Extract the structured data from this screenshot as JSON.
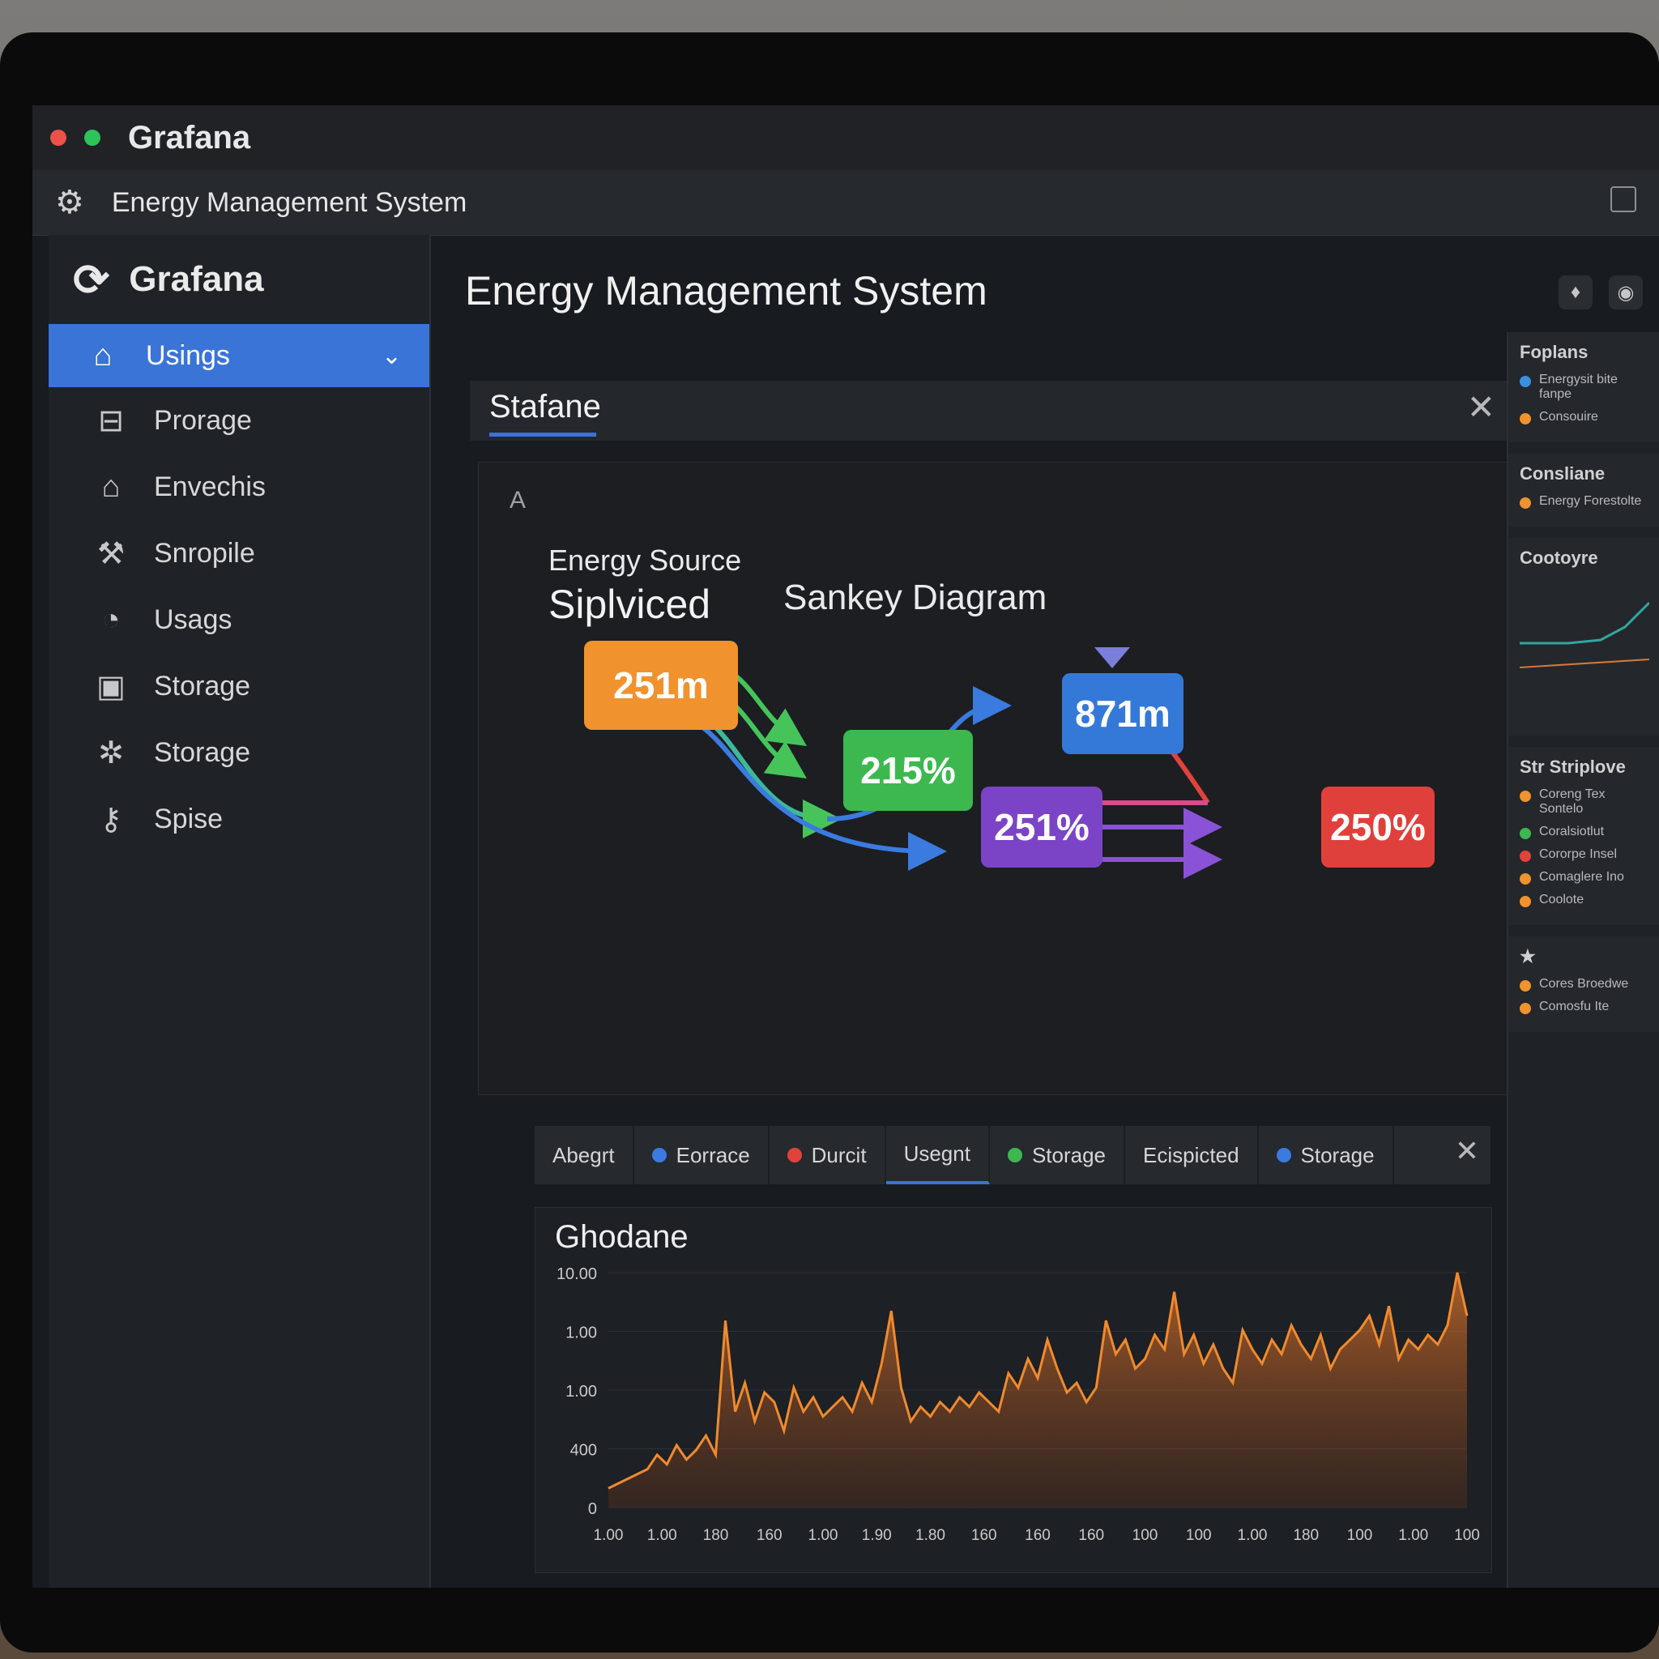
{
  "window": {
    "os_title": "Grafana",
    "app_title": "Energy Management System"
  },
  "sidebar": {
    "brand": "Grafana",
    "items": [
      {
        "label": "Usings",
        "icon": "home-icon",
        "active": true
      },
      {
        "label": "Prorage",
        "icon": "archive-icon"
      },
      {
        "label": "Envechis",
        "icon": "building-icon"
      },
      {
        "label": "Snropile",
        "icon": "tool-icon"
      },
      {
        "label": "Usags",
        "icon": "gauge-icon"
      },
      {
        "label": "Storage",
        "icon": "database-icon"
      },
      {
        "label": "Storage",
        "icon": "cog-cluster-icon"
      },
      {
        "label": "Spise",
        "icon": "key-icon"
      }
    ]
  },
  "main": {
    "page_title": "Energy Management System",
    "tab_label": "Stafane",
    "panel_marker": "A",
    "diagram": {
      "source_label": "Energy Source",
      "split_label": "Siplviced",
      "title": "Sankey Diagram",
      "nodes": [
        {
          "id": "source",
          "label": "251m",
          "color": "#f0922e"
        },
        {
          "id": "mid-green",
          "label": "215%",
          "color": "#3db84f"
        },
        {
          "id": "top-blue",
          "label": "871m",
          "color": "#3479d8"
        },
        {
          "id": "mid-purple",
          "label": "251%",
          "color": "#7b44c7"
        },
        {
          "id": "right-red",
          "label": "250%",
          "color": "#e0403c"
        }
      ]
    },
    "legend": [
      {
        "label": "Abegrt",
        "color": null
      },
      {
        "label": "Eorrace",
        "color": "#3b7be0"
      },
      {
        "label": "Durcit",
        "color": "#e0433b"
      },
      {
        "label": "Usegnt",
        "color": null,
        "selected": true
      },
      {
        "label": "Storage",
        "color": "#3db84f"
      },
      {
        "label": "Ecispicted",
        "color": null
      },
      {
        "label": "Storage",
        "color": "#3b7be0"
      }
    ],
    "chart_title": "Ghodane"
  },
  "chart_data": {
    "type": "area",
    "title": "Ghodane",
    "y_tick_labels": [
      "10.00",
      "1.00",
      "1.00",
      "400",
      "0"
    ],
    "x_tick_labels": [
      "1.00",
      "1.00",
      "180",
      "160",
      "1.00",
      "1.90",
      "1.80",
      "160",
      "160",
      "160",
      "100",
      "100",
      "1.00",
      "180",
      "100",
      "1.00",
      "100"
    ],
    "series": [
      {
        "color": "#f08a2e",
        "values": [
          8,
          10,
          12,
          14,
          16,
          22,
          18,
          26,
          20,
          24,
          30,
          22,
          78,
          40,
          52,
          36,
          48,
          44,
          32,
          50,
          40,
          46,
          38,
          42,
          46,
          40,
          52,
          44,
          60,
          82,
          50,
          36,
          42,
          38,
          44,
          40,
          46,
          42,
          48,
          44,
          40,
          56,
          50,
          62,
          54,
          70,
          58,
          48,
          52,
          44,
          50,
          78,
          64,
          70,
          58,
          62,
          72,
          66,
          90,
          64,
          72,
          60,
          68,
          58,
          52,
          74,
          66,
          60,
          70,
          64,
          76,
          68,
          62,
          72,
          58,
          66,
          70,
          74,
          80,
          68,
          84,
          62,
          70,
          66,
          72,
          68,
          76,
          98,
          80
        ]
      }
    ],
    "grid": true,
    "legend": "none"
  },
  "right_panel": {
    "sections": [
      {
        "title": "Foplans",
        "items": [
          {
            "text": "Energysit bite fanpe",
            "color": "#3b8fe0"
          },
          {
            "text": "Consouire",
            "color": "#f0922e"
          }
        ]
      },
      {
        "title": "Consliane",
        "items": [
          {
            "text": "Energy Forestolte",
            "color": "#f0922e"
          }
        ]
      },
      {
        "title": "Cootoyre",
        "items": []
      },
      {
        "title": "Str Striplove",
        "items": [
          {
            "text": "Coreng Tex Sontelo",
            "color": "#f0922e"
          },
          {
            "text": "Coralsiotlut",
            "color": "#3db84f"
          },
          {
            "text": "Cororpe Insel",
            "color": "#e0433b"
          },
          {
            "text": "Comaglere Ino",
            "color": "#f0922e"
          },
          {
            "text": "Coolote",
            "color": "#f0922e"
          }
        ]
      },
      {
        "title": "",
        "items": [
          {
            "text": "Cores Broedwe",
            "color": "#f0922e"
          },
          {
            "text": "Comosfu Ite",
            "color": "#f0922e"
          }
        ]
      }
    ]
  }
}
